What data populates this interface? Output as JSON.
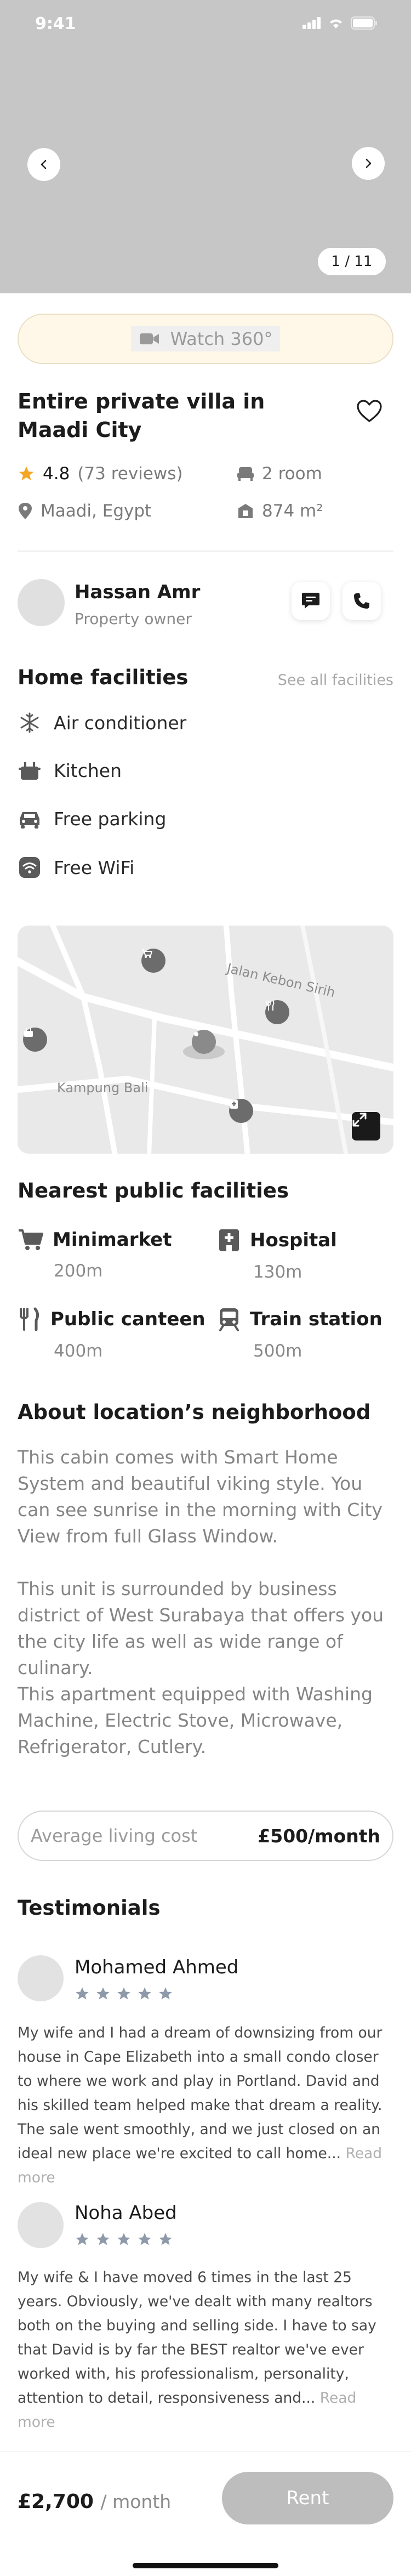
{
  "status_bar": {
    "time": "9:41"
  },
  "gallery": {
    "counter": "1 / 11"
  },
  "watch_button": {
    "label": "Watch 360°"
  },
  "property": {
    "title": "Entire private villa in Maadi City",
    "rating": "4.8",
    "reviews": "(73 reviews)",
    "rooms": "2 room",
    "location": "Maadi, Egypt",
    "area": "874 m²"
  },
  "owner": {
    "name": "Hassan Amr",
    "role": "Property owner"
  },
  "home_facilities": {
    "title": "Home facilities",
    "see_all": "See all facilities",
    "items": [
      {
        "label": "Air conditioner",
        "icon": "snowflake-icon"
      },
      {
        "label": "Kitchen",
        "icon": "kitchen-icon"
      },
      {
        "label": "Free parking",
        "icon": "car-icon"
      },
      {
        "label": "Free WiFi",
        "icon": "wifi-icon"
      }
    ]
  },
  "map": {
    "street_label": "Jalan Kebon Sirih",
    "area_label": "Kampung Bali"
  },
  "nearest": {
    "title": "Nearest public facilities",
    "items": [
      {
        "name": "Minimarket",
        "distance": "200m",
        "icon": "cart-icon"
      },
      {
        "name": "Hospital",
        "distance": "130m",
        "icon": "hospital-icon"
      },
      {
        "name": "Public canteen",
        "distance": "400m",
        "icon": "fork-knife-icon"
      },
      {
        "name": "Train station",
        "distance": "500m",
        "icon": "train-icon"
      }
    ]
  },
  "neighborhood": {
    "title": "About location’s neighborhood",
    "paragraphs": [
      "This cabin comes with Smart Home System and beautiful viking style. You can see sunrise in the morning with City View from full Glass Window.",
      "This unit is surrounded by business district of West Surabaya that offers you the city life as well as wide range of culinary.",
      "This apartment equipped with Washing Machine, Electric Stove, Microwave, Refrigerator, Cutlery."
    ]
  },
  "living_cost": {
    "label": "Average living cost",
    "value": "£500/month"
  },
  "testimonials": {
    "title": "Testimonials",
    "read_more": "Read more",
    "items": [
      {
        "name": "Mohamed Ahmed",
        "stars": 5,
        "text": "My wife and I had a dream of downsizing from our house in Cape Elizabeth into a small condo closer to where we work and play in Portland. David and his skilled team helped make that dream a reality. The sale went smoothly, and we just closed on an ideal new place we're excited to call home..."
      },
      {
        "name": "Noha Abed",
        "stars": 5,
        "text": "My wife & I have moved 6 times in the last 25 years. Obviously, we've dealt with many realtors both on the buying and selling side. I have to say that David is by far the BEST realtor we've ever worked with, his professionalism, personality, attention to detail, responsiveness and..."
      }
    ]
  },
  "footer": {
    "price": "£2,700",
    "period": "/ month",
    "rent_label": "Rent"
  },
  "colors": {
    "accent_star": "#f5a623",
    "rent_disabled": "#bdbdbd",
    "watch_bg": "#fff8e8"
  }
}
